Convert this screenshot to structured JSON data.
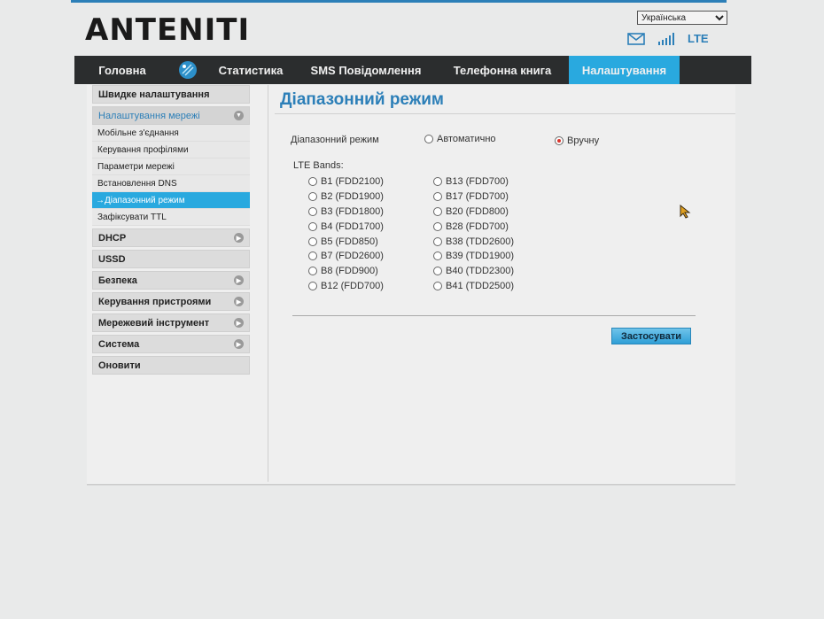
{
  "brand": {
    "logo": "ANTENITI"
  },
  "header": {
    "language": "Українська",
    "network_type": "LTE"
  },
  "nav": {
    "items": [
      {
        "label": "Головна"
      },
      {
        "label": "Статистика"
      },
      {
        "label": "SMS Повідомлення"
      },
      {
        "label": "Телефонна книга"
      },
      {
        "label": "Налаштування"
      }
    ],
    "active_index": 4
  },
  "sidebar": {
    "quick_setup": "Швидке налаштування",
    "network_settings": "Налаштування мережі",
    "network_subitems": [
      {
        "label": "Мобільне з'єднання"
      },
      {
        "label": "Керування профілями"
      },
      {
        "label": "Параметри мережі"
      },
      {
        "label": "Встановлення DNS"
      },
      {
        "label": "→Діапазонний режим"
      },
      {
        "label": "Зафіксувати TTL"
      }
    ],
    "groups": [
      {
        "label": "DHCP"
      },
      {
        "label": "USSD"
      },
      {
        "label": "Безпека"
      },
      {
        "label": "Керування пристроями"
      },
      {
        "label": "Мережевий інструмент"
      },
      {
        "label": "Система"
      },
      {
        "label": "Оновити"
      }
    ]
  },
  "main": {
    "title": "Діапазонний режим",
    "mode_label": "Діапазонний режим",
    "mode_auto": "Автоматично",
    "mode_manual": "Вручну",
    "selected_mode": "manual",
    "bands_label": "LTE Bands:",
    "bands_left": [
      "B1 (FDD2100)",
      "B2 (FDD1900)",
      "B3 (FDD1800)",
      "B4 (FDD1700)",
      "B5 (FDD850)",
      "B7 (FDD2600)",
      "B8 (FDD900)",
      "B12 (FDD700)"
    ],
    "bands_right": [
      "B13 (FDD700)",
      "B17 (FDD700)",
      "B20 (FDD800)",
      "B28 (FDD700)",
      "B38 (TDD2600)",
      "B39 (TDD1900)",
      "B40 (TDD2300)",
      "B41 (TDD2500)"
    ],
    "apply_label": "Застосувати"
  },
  "colors": {
    "accent": "#29a9df",
    "navbar": "#2b2d2e",
    "title": "#2c7fb8",
    "radio_selected": "#d9342b"
  }
}
